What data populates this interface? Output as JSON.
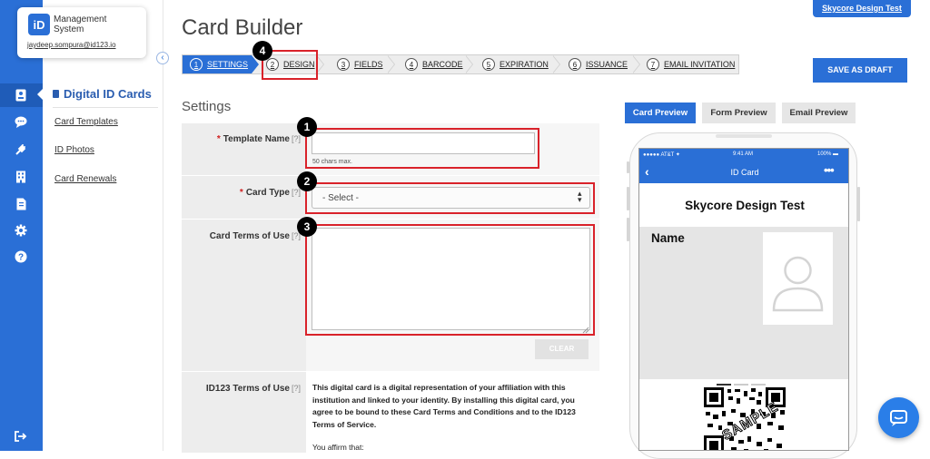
{
  "org": {
    "logo_text": "iD",
    "name": "Management System",
    "email": "jaydeep.sompura@id123.io"
  },
  "rail": {
    "icons": [
      "id-card-icon",
      "chat-icon",
      "plug-icon",
      "building-icon",
      "document-icon",
      "gear-icon",
      "help-icon",
      "logout-icon"
    ],
    "active": "id-card-icon"
  },
  "subnav": {
    "section_title": "Digital ID Cards",
    "items": [
      {
        "label": "Card Templates"
      },
      {
        "label": "ID Photos"
      },
      {
        "label": "Card Renewals"
      }
    ]
  },
  "header": {
    "title": "Card Builder",
    "org_tab": "Skycore Design Test",
    "save_label": "SAVE AS DRAFT"
  },
  "steps": [
    {
      "num": "1",
      "label": "SETTINGS",
      "active": true
    },
    {
      "num": "2",
      "label": "DESIGN"
    },
    {
      "num": "3",
      "label": "FIELDS"
    },
    {
      "num": "4",
      "label": "BARCODE"
    },
    {
      "num": "5",
      "label": "EXPIRATION"
    },
    {
      "num": "6",
      "label": "ISSUANCE"
    },
    {
      "num": "7",
      "label": "EMAIL INVITATION"
    }
  ],
  "form": {
    "heading": "Settings",
    "required_mark": "*",
    "help_mark": "[?]",
    "template_name": {
      "label": "Template Name",
      "value": "",
      "hint": "50 chars max."
    },
    "card_type": {
      "label": "Card Type",
      "value": "- Select -"
    },
    "card_terms": {
      "label": "Card Terms of Use",
      "value": ""
    },
    "clear_label": "CLEAR",
    "id123_terms": {
      "label": "ID123 Terms of Use",
      "text": "This digital card is a digital representation of your affiliation with this institution and linked to your identity. By installing this digital card, you agree to be bound to these Card Terms and Conditions and to the ID123 Terms of Service.",
      "affirm": "You affirm that:"
    }
  },
  "annotations": {
    "badges": [
      "1",
      "2",
      "3",
      "4"
    ],
    "highlight_color": "#d9222a"
  },
  "preview": {
    "tabs": [
      {
        "label": "Card Preview",
        "active": true
      },
      {
        "label": "Form Preview"
      },
      {
        "label": "Email Preview"
      }
    ],
    "status_carrier": "●●●●● AT&T ✦",
    "status_time": "9:41 AM",
    "status_battery": "100% ▬",
    "nav_title": "ID Card",
    "card_org": "Skycore Design Test",
    "name_label": "Name",
    "watermark": "SAMPLE"
  },
  "colors": {
    "accent": "#2a6fd6",
    "rail": "#2a6fd6",
    "danger": "#d9222a"
  }
}
